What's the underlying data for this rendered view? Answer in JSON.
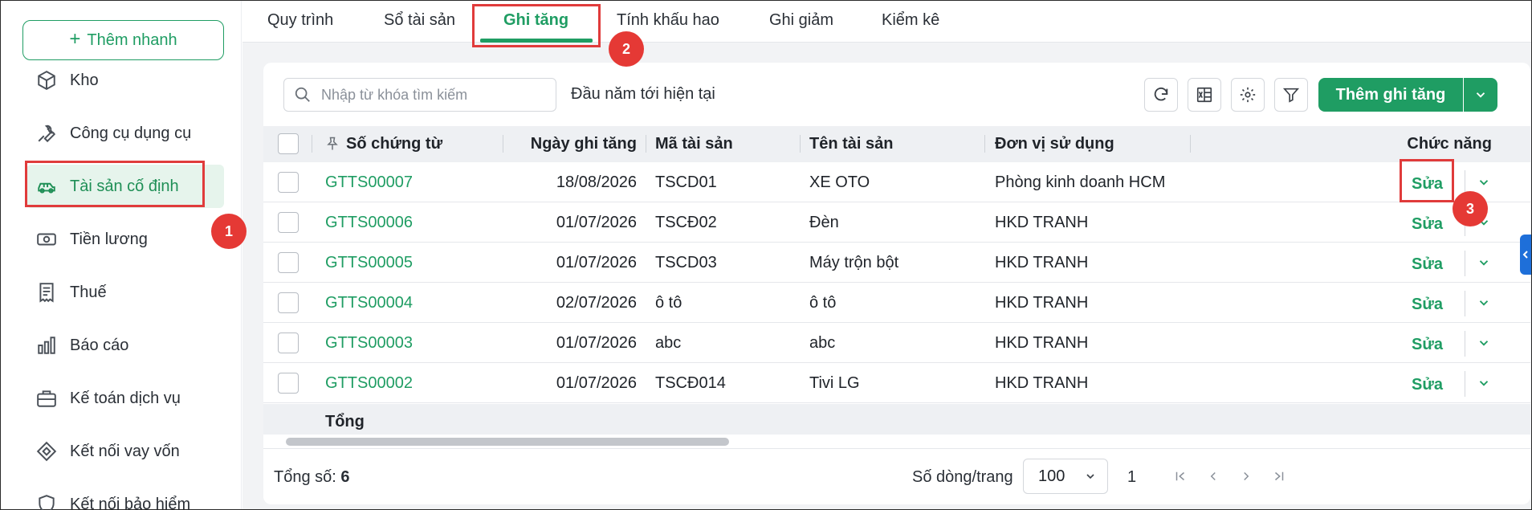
{
  "sidebar": {
    "quick_add_label": "Thêm nhanh",
    "items": [
      {
        "label": "Kho",
        "icon": "box-icon"
      },
      {
        "label": "Công cụ dụng cụ",
        "icon": "wrench-icon"
      },
      {
        "label": "Tài sản cố định",
        "icon": "car-icon",
        "active": true
      },
      {
        "label": "Tiền lương",
        "icon": "money-icon"
      },
      {
        "label": "Thuế",
        "icon": "receipt-icon"
      },
      {
        "label": "Báo cáo",
        "icon": "bar-chart-icon"
      },
      {
        "label": "Kế toán dịch vụ",
        "icon": "briefcase-icon"
      },
      {
        "label": "Kết nối vay vốn",
        "icon": "link-icon"
      },
      {
        "label": "Kết nối bảo hiểm",
        "icon": "shield-icon"
      }
    ]
  },
  "tabs": [
    {
      "label": "Quy trình"
    },
    {
      "label": "Sổ tài sản"
    },
    {
      "label": "Ghi tăng",
      "active": true
    },
    {
      "label": "Tính khấu hao"
    },
    {
      "label": "Ghi giảm"
    },
    {
      "label": "Kiểm kê"
    }
  ],
  "toolbar": {
    "search_placeholder": "Nhập từ khóa tìm kiếm",
    "period_label": "Đầu năm tới hiện tại",
    "add_button_label": "Thêm ghi tăng"
  },
  "table": {
    "columns": [
      "Số chứng từ",
      "Ngày ghi tăng",
      "Mã tài sản",
      "Tên tài sản",
      "Đơn vị sử dụng",
      "Chức năng"
    ],
    "rows": [
      {
        "doc": "GTTS00007",
        "date": "18/08/2026",
        "code": "TSCD01",
        "name": "XE OTO",
        "unit": "Phòng kinh doanh HCM",
        "action": "Sửa"
      },
      {
        "doc": "GTTS00006",
        "date": "01/07/2026",
        "code": "TSCĐ02",
        "name": "Đèn",
        "unit": "HKD TRANH",
        "action": "Sửa"
      },
      {
        "doc": "GTTS00005",
        "date": "01/07/2026",
        "code": "TSCD03",
        "name": "Máy trộn bột",
        "unit": "HKD TRANH",
        "action": "Sửa"
      },
      {
        "doc": "GTTS00004",
        "date": "02/07/2026",
        "code": "ô tô",
        "name": "ô tô",
        "unit": "HKD TRANH",
        "action": "Sửa"
      },
      {
        "doc": "GTTS00003",
        "date": "01/07/2026",
        "code": "abc",
        "name": "abc",
        "unit": "HKD TRANH",
        "action": "Sửa"
      },
      {
        "doc": "GTTS00002",
        "date": "01/07/2026",
        "code": "TSCĐ014",
        "name": "Tivi LG",
        "unit": "HKD TRANH",
        "action": "Sửa"
      }
    ],
    "total_label": "Tổng"
  },
  "footer": {
    "total_label": "Tổng số:",
    "total_value": "6",
    "page_size_label": "Số dòng/trang",
    "page_size_value": "100",
    "current_page": "1"
  },
  "annotations": [
    "1",
    "2",
    "3"
  ],
  "colors": {
    "accent": "#1f9d63",
    "highlight": "#e03b3b",
    "badge": "#e53935"
  }
}
